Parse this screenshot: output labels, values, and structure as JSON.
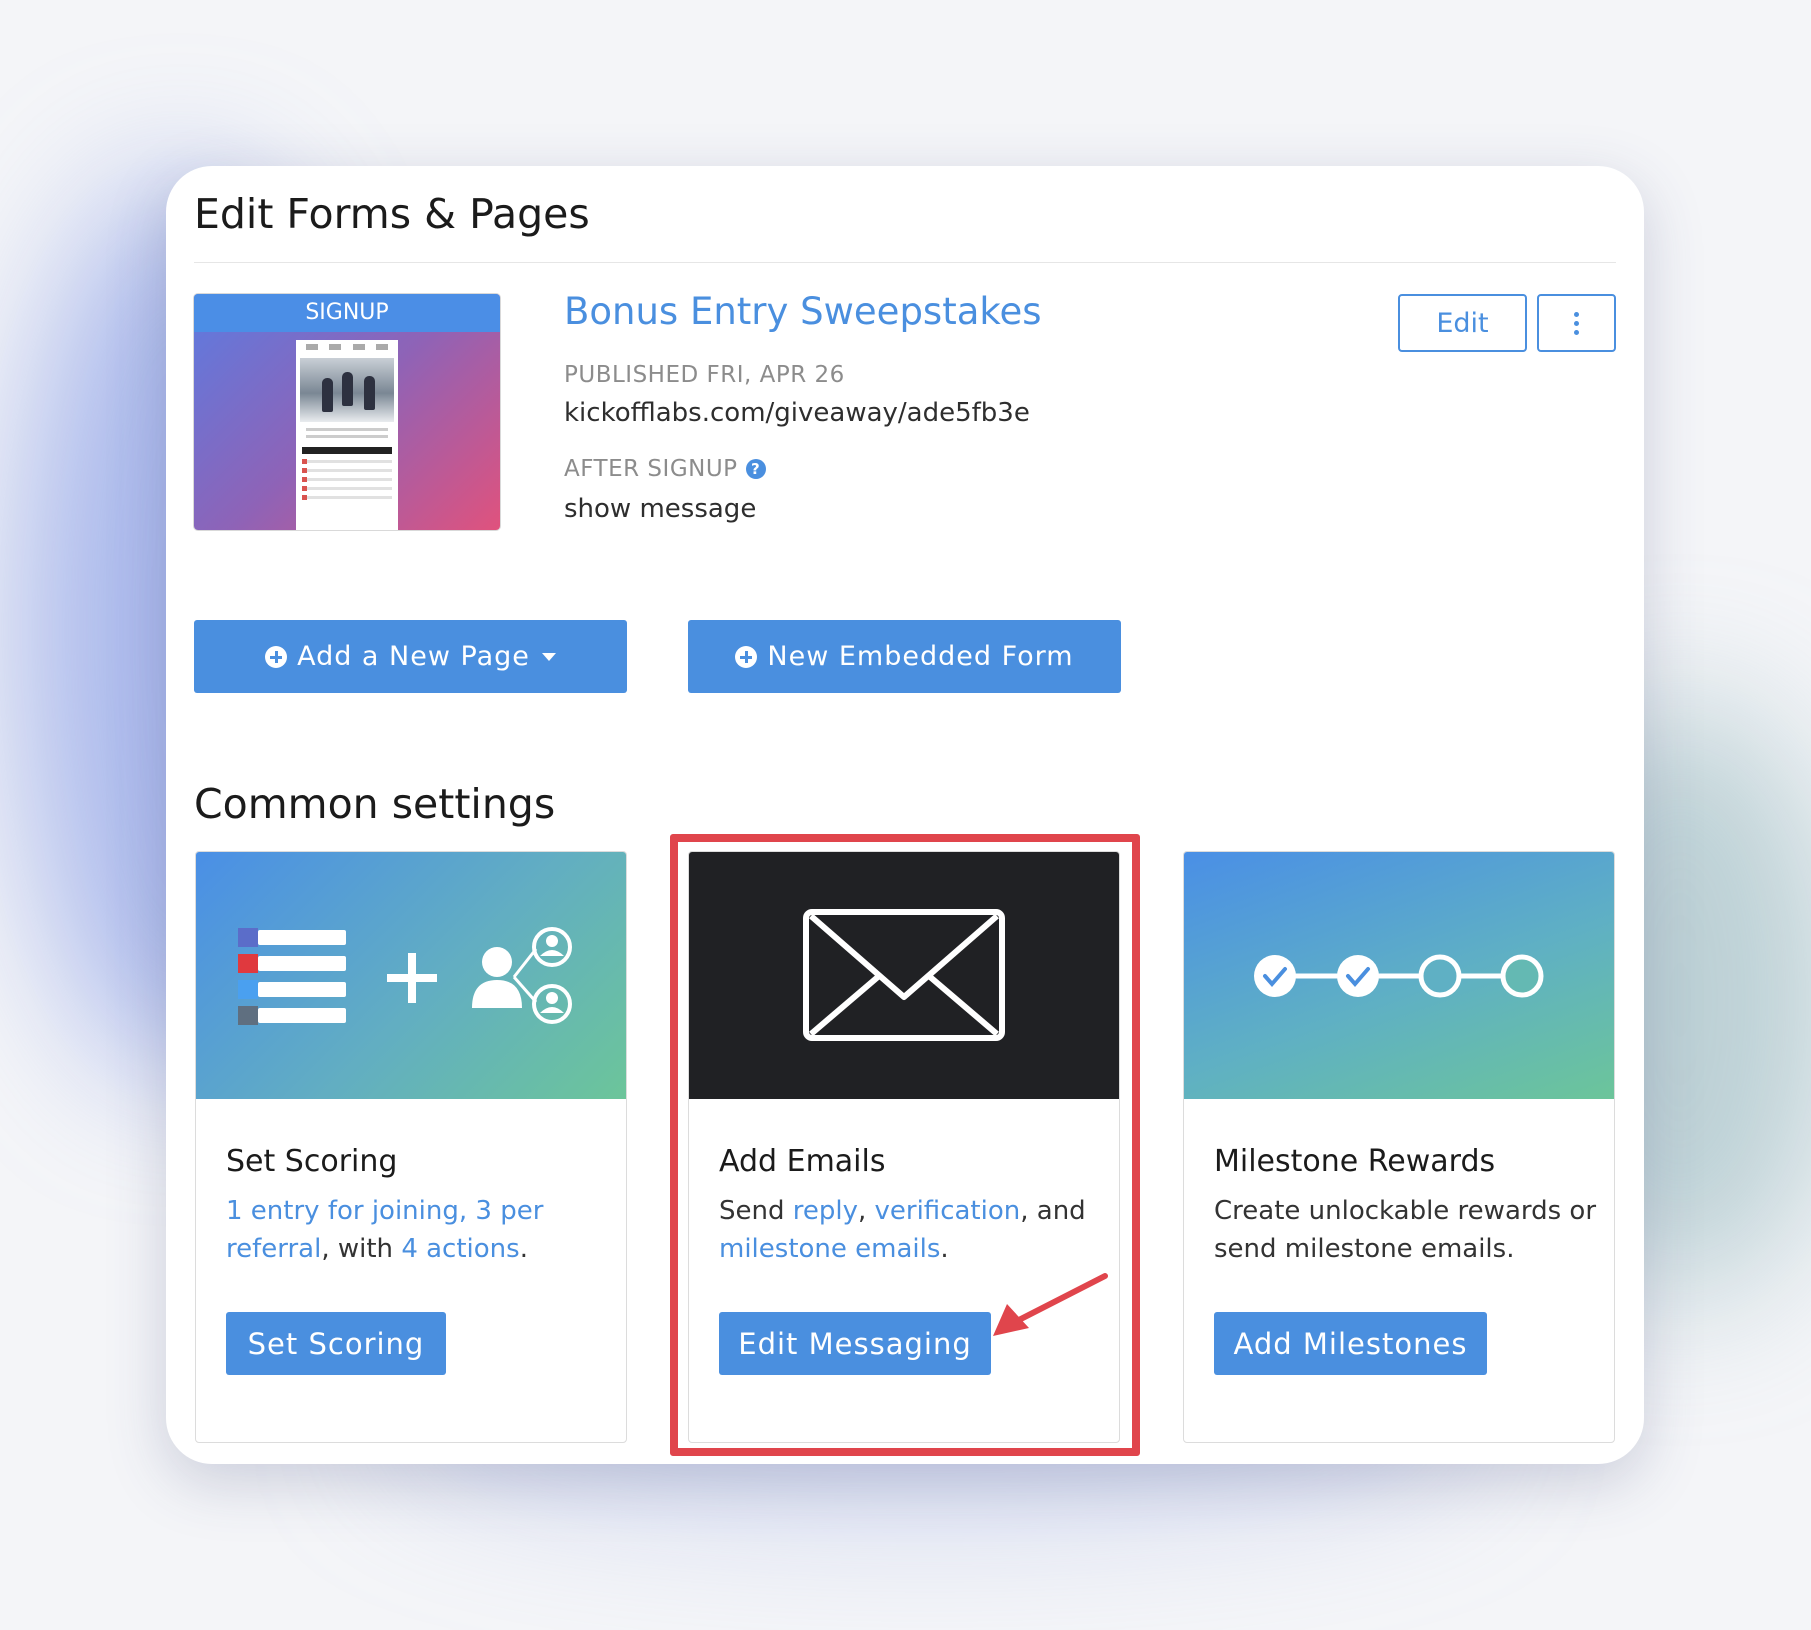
{
  "page": {
    "title": "Edit Forms & Pages"
  },
  "thumbnail": {
    "label": "SIGNUP"
  },
  "program": {
    "name": "Bonus Entry Sweepstakes",
    "published_label": "PUBLISHED FRI, APR 26",
    "url": "kickofflabs.com/giveaway/ade5fb3e",
    "after_signup_label": "AFTER SIGNUP",
    "after_signup_value": "show message",
    "help_icon": "question-circle-icon"
  },
  "toolbar": {
    "edit_label": "Edit",
    "more_icon": "vertical-ellipsis-icon",
    "add_page_label": "Add a New Page",
    "new_form_label": "New Embedded Form"
  },
  "common_settings": {
    "title": "Common settings",
    "tiles": [
      {
        "title": "Set Scoring",
        "desc_link1": "1 entry for joining, 3 per referral",
        "desc_text1": ", with ",
        "desc_link2": "4 actions",
        "desc_text2": ".",
        "button": "Set Scoring",
        "icon": "scoring-list-plus-referral-icon",
        "gradient": [
          "#4a8fe6",
          "#6cc59a"
        ]
      },
      {
        "title": "Add Emails",
        "desc_text0": "Send ",
        "desc_link1": "reply",
        "desc_text1": ", ",
        "desc_link2": "verification",
        "desc_text2": ", and ",
        "desc_link3": "milestone emails",
        "desc_text3": ".",
        "button": "Edit Messaging",
        "icon": "envelope-icon",
        "background": "#202124"
      },
      {
        "title": "Milestone Rewards",
        "desc": "Create unlockable rewards or send milestone emails.",
        "button": "Add Milestones",
        "icon": "milestone-progress-icon",
        "gradient": [
          "#4a8fe6",
          "#6cc59a"
        ]
      }
    ]
  },
  "annotations": {
    "highlight_color": "#e0454c",
    "arrow_icon": "red-arrow-icon"
  },
  "colors": {
    "accent": "#4a8fdf"
  }
}
